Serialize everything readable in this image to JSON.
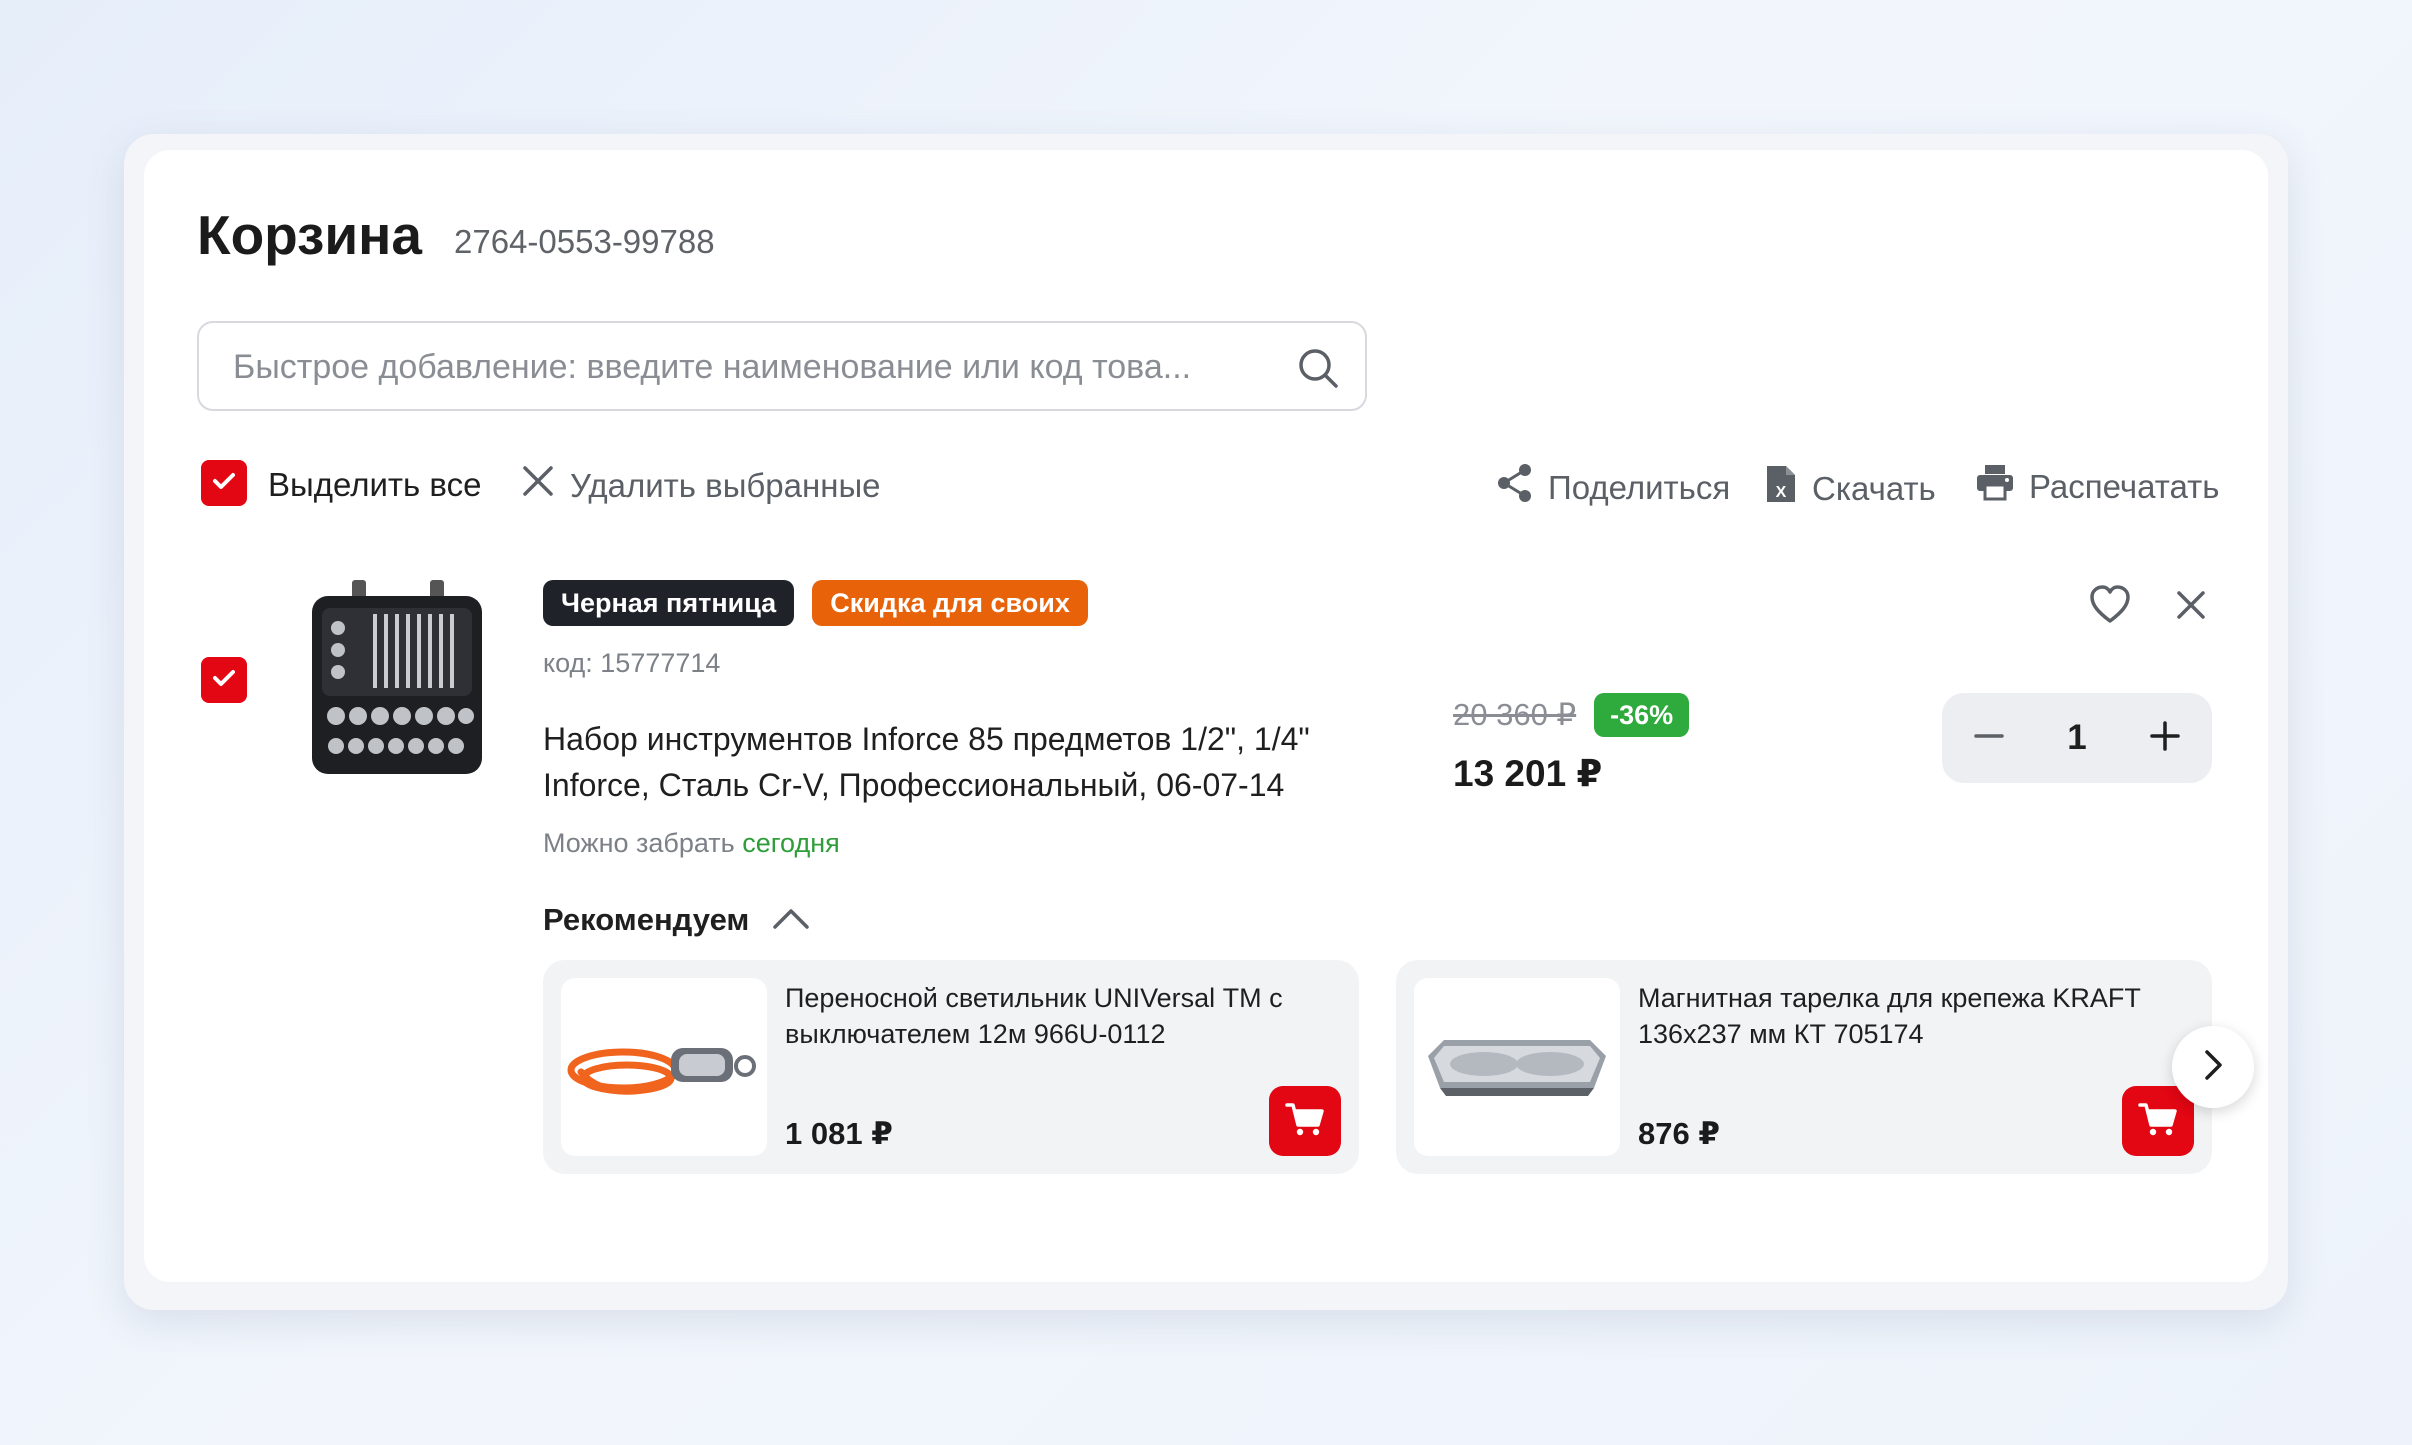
{
  "header": {
    "title": "Корзина",
    "order_number": "2764-0553-99788"
  },
  "search": {
    "placeholder": "Быстрое добавление: введите наименование или код това..."
  },
  "toolbar": {
    "select_all": "Выделить все",
    "delete_selected": "Удалить выбранные",
    "share": "Поделиться",
    "download": "Скачать",
    "print": "Распечатать"
  },
  "item": {
    "badges": [
      "Черная пятница",
      "Скидка для своих"
    ],
    "code": "код: 15777714",
    "name": "Набор инструментов Inforce 85 предметов 1/2\", 1/4\" Inforce, Сталь Cr-V, Профессиональный, 06-07-14",
    "pickup_label": "Можно забрать",
    "pickup_when": "сегодня",
    "old_price": "20 360 ₽",
    "discount": "-36%",
    "price": "13 201 ₽",
    "quantity": "1",
    "selected": true
  },
  "recommendations": {
    "title": "Рекомендуем",
    "items": [
      {
        "name": "Переносной светильник UNIVersal ТМ с выключателем 12м 966U-0112",
        "price": "1 081 ₽"
      },
      {
        "name": "Магнитная тарелка для крепежа KRAFT 136x237 мм КТ 705174",
        "price": "876 ₽"
      }
    ]
  },
  "colors": {
    "accent_red": "#e30613",
    "badge_dark": "#1f2329",
    "badge_orange": "#e8620a",
    "discount_green": "#2faa3d"
  },
  "icons": [
    "search-icon",
    "check-icon",
    "close-icon",
    "share-icon",
    "excel-file-icon",
    "printer-icon",
    "heart-icon",
    "minus-icon",
    "plus-icon",
    "chevron-up-icon",
    "cart-icon",
    "chevron-right-icon"
  ]
}
